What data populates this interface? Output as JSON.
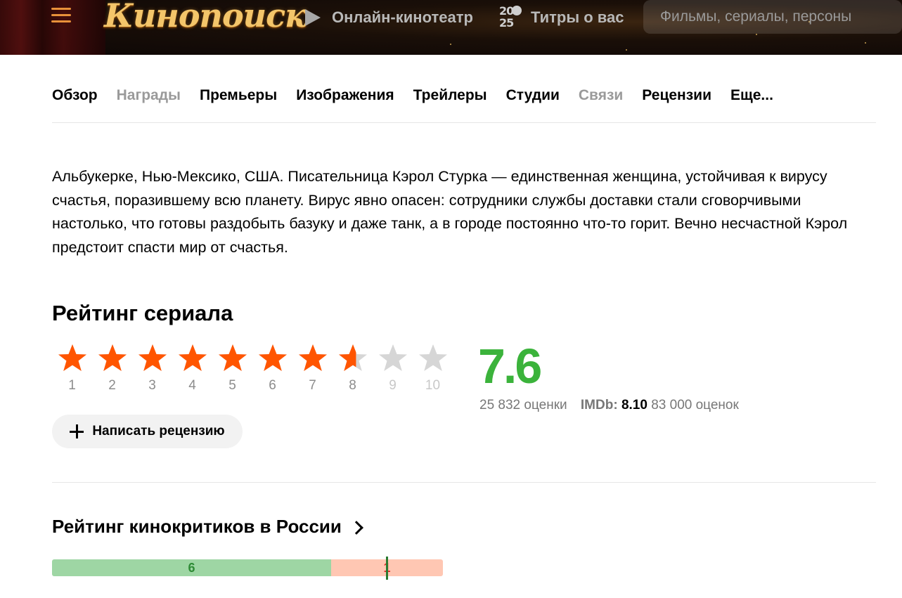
{
  "header": {
    "logo_text": "Кинопоиск",
    "nav_online": "Онлайн-кинотеатр",
    "nav_titles": "Титры о вас",
    "badge_top": "20",
    "badge_bottom": "25",
    "search_placeholder": "Фильмы, сериалы, персоны"
  },
  "tabs": [
    {
      "label": "Обзор",
      "dim": false
    },
    {
      "label": "Награды",
      "dim": true
    },
    {
      "label": "Премьеры",
      "dim": false
    },
    {
      "label": "Изображения",
      "dim": false
    },
    {
      "label": "Трейлеры",
      "dim": false
    },
    {
      "label": "Студии",
      "dim": false
    },
    {
      "label": "Связи",
      "dim": true
    },
    {
      "label": "Рецензии",
      "dim": false
    },
    {
      "label": "Еще...",
      "dim": false
    }
  ],
  "description": "Альбукерке, Нью-Мексико, США. Писательница Кэрол Стурка — единственная женщина, устойчивая к вирусу счастья, поразившему всю планету. Вирус явно опасен: сотрудники службы доставки стали сговорчивыми настолько, что готовы раздобыть базуку и даже танк, а в городе постоянно что-то горит. Вечно несчастной Кэрол предстоит спасти мир от счастья.",
  "rating": {
    "title": "Рейтинг сериала",
    "value": "7.6",
    "value_num": 7.6,
    "votes": "25 832 оценки",
    "imdb_label": "IMDb:",
    "imdb_value": "8.10",
    "imdb_votes": "83 000 оценок",
    "stars": [
      "1",
      "2",
      "3",
      "4",
      "5",
      "6",
      "7",
      "8",
      "9",
      "10"
    ],
    "colors": {
      "filled": "#ff5500",
      "empty": "#d6d6d6",
      "value": "#3bb33b"
    }
  },
  "write_review": "Написать рецензию",
  "critics": {
    "title": "Рейтинг кинокритиков в России",
    "positive": 6,
    "negative": 1,
    "positive_label": "6",
    "negative_label": "1"
  }
}
